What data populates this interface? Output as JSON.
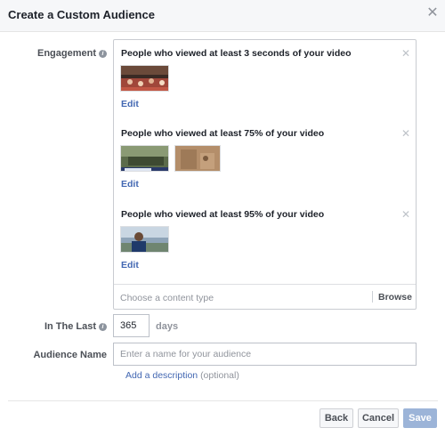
{
  "dialog": {
    "title": "Create a Custom Audience",
    "close_icon": "close-icon"
  },
  "engagement": {
    "label": "Engagement",
    "info_icon": "info-icon",
    "groups": [
      {
        "title": "People who viewed at least 3 seconds of your video",
        "edit_label": "Edit",
        "remove_icon": "close-icon"
      },
      {
        "title": "People who viewed at least 75% of your video",
        "edit_label": "Edit",
        "remove_icon": "close-icon"
      },
      {
        "title": "People who viewed at least 95% of your video",
        "edit_label": "Edit",
        "remove_icon": "close-icon"
      }
    ],
    "content_type_placeholder": "Choose a content type",
    "browse_label": "Browse"
  },
  "in_the_last": {
    "label": "In The Last",
    "info_icon": "info-icon",
    "value": "365",
    "unit": "days"
  },
  "audience_name": {
    "label": "Audience Name",
    "placeholder": "Enter a name for your audience",
    "value": "",
    "add_description_label": "Add a description",
    "optional_label": "(optional)"
  },
  "footer": {
    "back_label": "Back",
    "cancel_label": "Cancel",
    "save_label": "Save"
  },
  "colors": {
    "link": "#4267b2",
    "save_button_disabled": "#9cb4d8",
    "header_bg": "#f6f7f9"
  }
}
